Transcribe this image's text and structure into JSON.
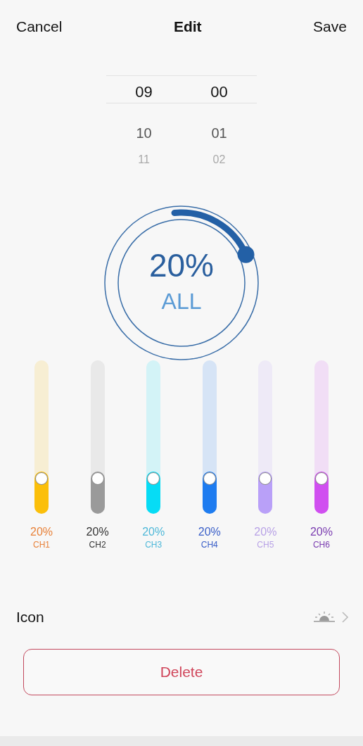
{
  "header": {
    "cancel": "Cancel",
    "title": "Edit",
    "save": "Save"
  },
  "time_picker": {
    "hours": [
      {
        "label": "09",
        "selected": true
      },
      {
        "label": "10",
        "selected": false
      },
      {
        "label": "11",
        "selected": false
      }
    ],
    "minutes": [
      {
        "label": "00",
        "selected": true
      },
      {
        "label": "01",
        "selected": false
      },
      {
        "label": "02",
        "selected": false
      }
    ]
  },
  "dial": {
    "value": "20%",
    "label": "ALL"
  },
  "channels": [
    {
      "name": "CH1",
      "reading": "20%",
      "color": "#fbbf0a"
    },
    {
      "name": "CH2",
      "reading": "20%",
      "color": "#9a9a9a"
    },
    {
      "name": "CH3",
      "reading": "20%",
      "color": "#06dcf5"
    },
    {
      "name": "CH4",
      "reading": "20%",
      "color": "#1e7cf0"
    },
    {
      "name": "CH5",
      "reading": "20%",
      "color": "#b9a0f8"
    },
    {
      "name": "CH6",
      "reading": "20%",
      "color": "#d04ff0"
    }
  ],
  "icon_row": {
    "label": "Icon"
  },
  "delete_button": "Delete"
}
